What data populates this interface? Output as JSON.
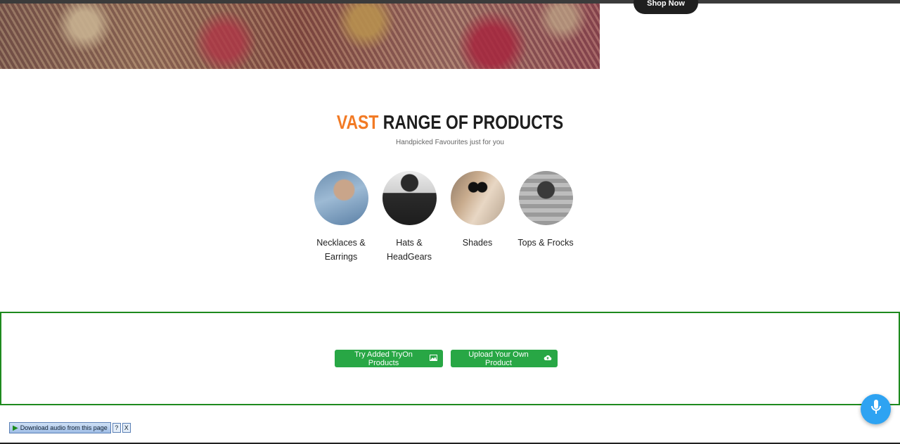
{
  "hero": {
    "shop_button": "Shop Now"
  },
  "section": {
    "title_accent": "VAST",
    "title_rest": " RANGE OF PRODUCTS",
    "subtitle": "Handpicked Favourites just for you",
    "accent_color": "#f27a24"
  },
  "categories": [
    {
      "label_line1": "Necklaces &",
      "label_line2": "Earrings"
    },
    {
      "label_line1": "Hats &",
      "label_line2": "HeadGears"
    },
    {
      "label_line1": "Shades",
      "label_line2": ""
    },
    {
      "label_line1": "Tops & Frocks",
      "label_line2": ""
    }
  ],
  "tryon": {
    "try_button": "Try Added TryOn Products",
    "upload_button": "Upload Your Own Product",
    "button_color": "#28a745",
    "border_color": "#1e8a1e"
  },
  "mic": {
    "icon": "microphone-icon",
    "color": "#2ea3f2"
  },
  "audio_toolbar": {
    "label": "Download audio from this page",
    "help": "?",
    "close": "X"
  }
}
